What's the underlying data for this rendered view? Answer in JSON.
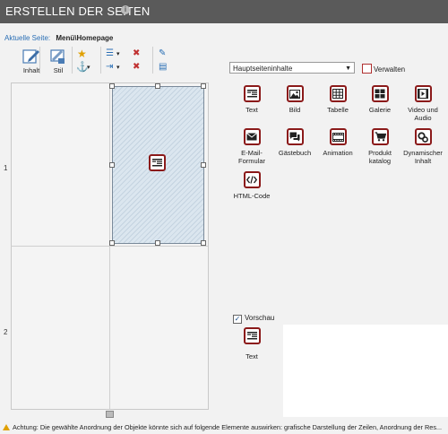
{
  "header": {
    "title": "ERSTELLEN DER SEITEN",
    "info_icon": "i"
  },
  "breadcrumb": {
    "label": "Aktuelle Seite:",
    "value": "Menü\\Homepage"
  },
  "toolbar": {
    "content_label": "Inhalt",
    "style_label": "Stil",
    "anchor_arrow": "▾",
    "align_arrow": "▾",
    "indent_arrow": "▾"
  },
  "layout_grid": {
    "row_labels": [
      "1",
      "2"
    ]
  },
  "panel": {
    "select_value": "Hauptseiteninhalte",
    "manage_label": "Verwalten",
    "widgets": [
      {
        "label": "Text",
        "icon": "text-icon"
      },
      {
        "label": "Bild",
        "icon": "image-icon"
      },
      {
        "label": "Tabelle",
        "icon": "table-icon"
      },
      {
        "label": "Galerie",
        "icon": "gallery-icon"
      },
      {
        "label": "Video und\nAudio",
        "icon": "video-icon"
      },
      {
        "label": "E-Mail-\nFormular",
        "icon": "email-icon"
      },
      {
        "label": "Gästebuch",
        "icon": "guestbook-icon"
      },
      {
        "label": "Animation",
        "icon": "animation-icon"
      },
      {
        "label": "Produkt\nkatalog",
        "icon": "cart-icon"
      },
      {
        "label": "Dynamischer\nInhalt",
        "icon": "dynamic-icon"
      },
      {
        "label": "HTML-Code",
        "icon": "code-icon"
      }
    ]
  },
  "preview": {
    "checkbox_label": "Vorschau",
    "checked": true,
    "widget_label": "Text"
  },
  "footer": {
    "warning_text": "Achtung: Die gewählte Anordnung der Objekte könnte sich auf folgende Elemente auswirken: grafische Darstellung der Zeilen, Anordnung der Res..."
  }
}
